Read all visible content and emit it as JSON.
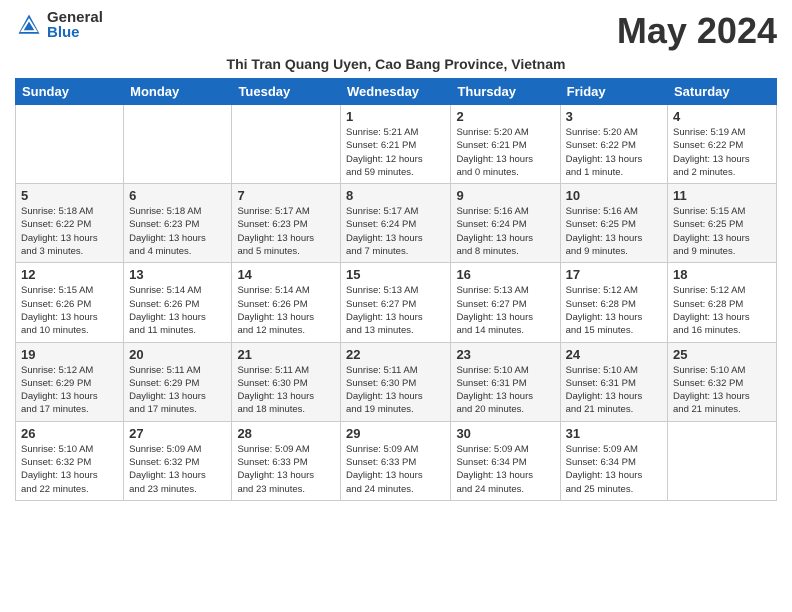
{
  "header": {
    "logo_general": "General",
    "logo_blue": "Blue",
    "month_title": "May 2024",
    "subtitle": "Thi Tran Quang Uyen, Cao Bang Province, Vietnam"
  },
  "weekdays": [
    "Sunday",
    "Monday",
    "Tuesday",
    "Wednesday",
    "Thursday",
    "Friday",
    "Saturday"
  ],
  "weeks": [
    [
      {
        "day": "",
        "info": ""
      },
      {
        "day": "",
        "info": ""
      },
      {
        "day": "",
        "info": ""
      },
      {
        "day": "1",
        "info": "Sunrise: 5:21 AM\nSunset: 6:21 PM\nDaylight: 12 hours\nand 59 minutes."
      },
      {
        "day": "2",
        "info": "Sunrise: 5:20 AM\nSunset: 6:21 PM\nDaylight: 13 hours\nand 0 minutes."
      },
      {
        "day": "3",
        "info": "Sunrise: 5:20 AM\nSunset: 6:22 PM\nDaylight: 13 hours\nand 1 minute."
      },
      {
        "day": "4",
        "info": "Sunrise: 5:19 AM\nSunset: 6:22 PM\nDaylight: 13 hours\nand 2 minutes."
      }
    ],
    [
      {
        "day": "5",
        "info": "Sunrise: 5:18 AM\nSunset: 6:22 PM\nDaylight: 13 hours\nand 3 minutes."
      },
      {
        "day": "6",
        "info": "Sunrise: 5:18 AM\nSunset: 6:23 PM\nDaylight: 13 hours\nand 4 minutes."
      },
      {
        "day": "7",
        "info": "Sunrise: 5:17 AM\nSunset: 6:23 PM\nDaylight: 13 hours\nand 5 minutes."
      },
      {
        "day": "8",
        "info": "Sunrise: 5:17 AM\nSunset: 6:24 PM\nDaylight: 13 hours\nand 7 minutes."
      },
      {
        "day": "9",
        "info": "Sunrise: 5:16 AM\nSunset: 6:24 PM\nDaylight: 13 hours\nand 8 minutes."
      },
      {
        "day": "10",
        "info": "Sunrise: 5:16 AM\nSunset: 6:25 PM\nDaylight: 13 hours\nand 9 minutes."
      },
      {
        "day": "11",
        "info": "Sunrise: 5:15 AM\nSunset: 6:25 PM\nDaylight: 13 hours\nand 9 minutes."
      }
    ],
    [
      {
        "day": "12",
        "info": "Sunrise: 5:15 AM\nSunset: 6:26 PM\nDaylight: 13 hours\nand 10 minutes."
      },
      {
        "day": "13",
        "info": "Sunrise: 5:14 AM\nSunset: 6:26 PM\nDaylight: 13 hours\nand 11 minutes."
      },
      {
        "day": "14",
        "info": "Sunrise: 5:14 AM\nSunset: 6:26 PM\nDaylight: 13 hours\nand 12 minutes."
      },
      {
        "day": "15",
        "info": "Sunrise: 5:13 AM\nSunset: 6:27 PM\nDaylight: 13 hours\nand 13 minutes."
      },
      {
        "day": "16",
        "info": "Sunrise: 5:13 AM\nSunset: 6:27 PM\nDaylight: 13 hours\nand 14 minutes."
      },
      {
        "day": "17",
        "info": "Sunrise: 5:12 AM\nSunset: 6:28 PM\nDaylight: 13 hours\nand 15 minutes."
      },
      {
        "day": "18",
        "info": "Sunrise: 5:12 AM\nSunset: 6:28 PM\nDaylight: 13 hours\nand 16 minutes."
      }
    ],
    [
      {
        "day": "19",
        "info": "Sunrise: 5:12 AM\nSunset: 6:29 PM\nDaylight: 13 hours\nand 17 minutes."
      },
      {
        "day": "20",
        "info": "Sunrise: 5:11 AM\nSunset: 6:29 PM\nDaylight: 13 hours\nand 17 minutes."
      },
      {
        "day": "21",
        "info": "Sunrise: 5:11 AM\nSunset: 6:30 PM\nDaylight: 13 hours\nand 18 minutes."
      },
      {
        "day": "22",
        "info": "Sunrise: 5:11 AM\nSunset: 6:30 PM\nDaylight: 13 hours\nand 19 minutes."
      },
      {
        "day": "23",
        "info": "Sunrise: 5:10 AM\nSunset: 6:31 PM\nDaylight: 13 hours\nand 20 minutes."
      },
      {
        "day": "24",
        "info": "Sunrise: 5:10 AM\nSunset: 6:31 PM\nDaylight: 13 hours\nand 21 minutes."
      },
      {
        "day": "25",
        "info": "Sunrise: 5:10 AM\nSunset: 6:32 PM\nDaylight: 13 hours\nand 21 minutes."
      }
    ],
    [
      {
        "day": "26",
        "info": "Sunrise: 5:10 AM\nSunset: 6:32 PM\nDaylight: 13 hours\nand 22 minutes."
      },
      {
        "day": "27",
        "info": "Sunrise: 5:09 AM\nSunset: 6:32 PM\nDaylight: 13 hours\nand 23 minutes."
      },
      {
        "day": "28",
        "info": "Sunrise: 5:09 AM\nSunset: 6:33 PM\nDaylight: 13 hours\nand 23 minutes."
      },
      {
        "day": "29",
        "info": "Sunrise: 5:09 AM\nSunset: 6:33 PM\nDaylight: 13 hours\nand 24 minutes."
      },
      {
        "day": "30",
        "info": "Sunrise: 5:09 AM\nSunset: 6:34 PM\nDaylight: 13 hours\nand 24 minutes."
      },
      {
        "day": "31",
        "info": "Sunrise: 5:09 AM\nSunset: 6:34 PM\nDaylight: 13 hours\nand 25 minutes."
      },
      {
        "day": "",
        "info": ""
      }
    ]
  ]
}
